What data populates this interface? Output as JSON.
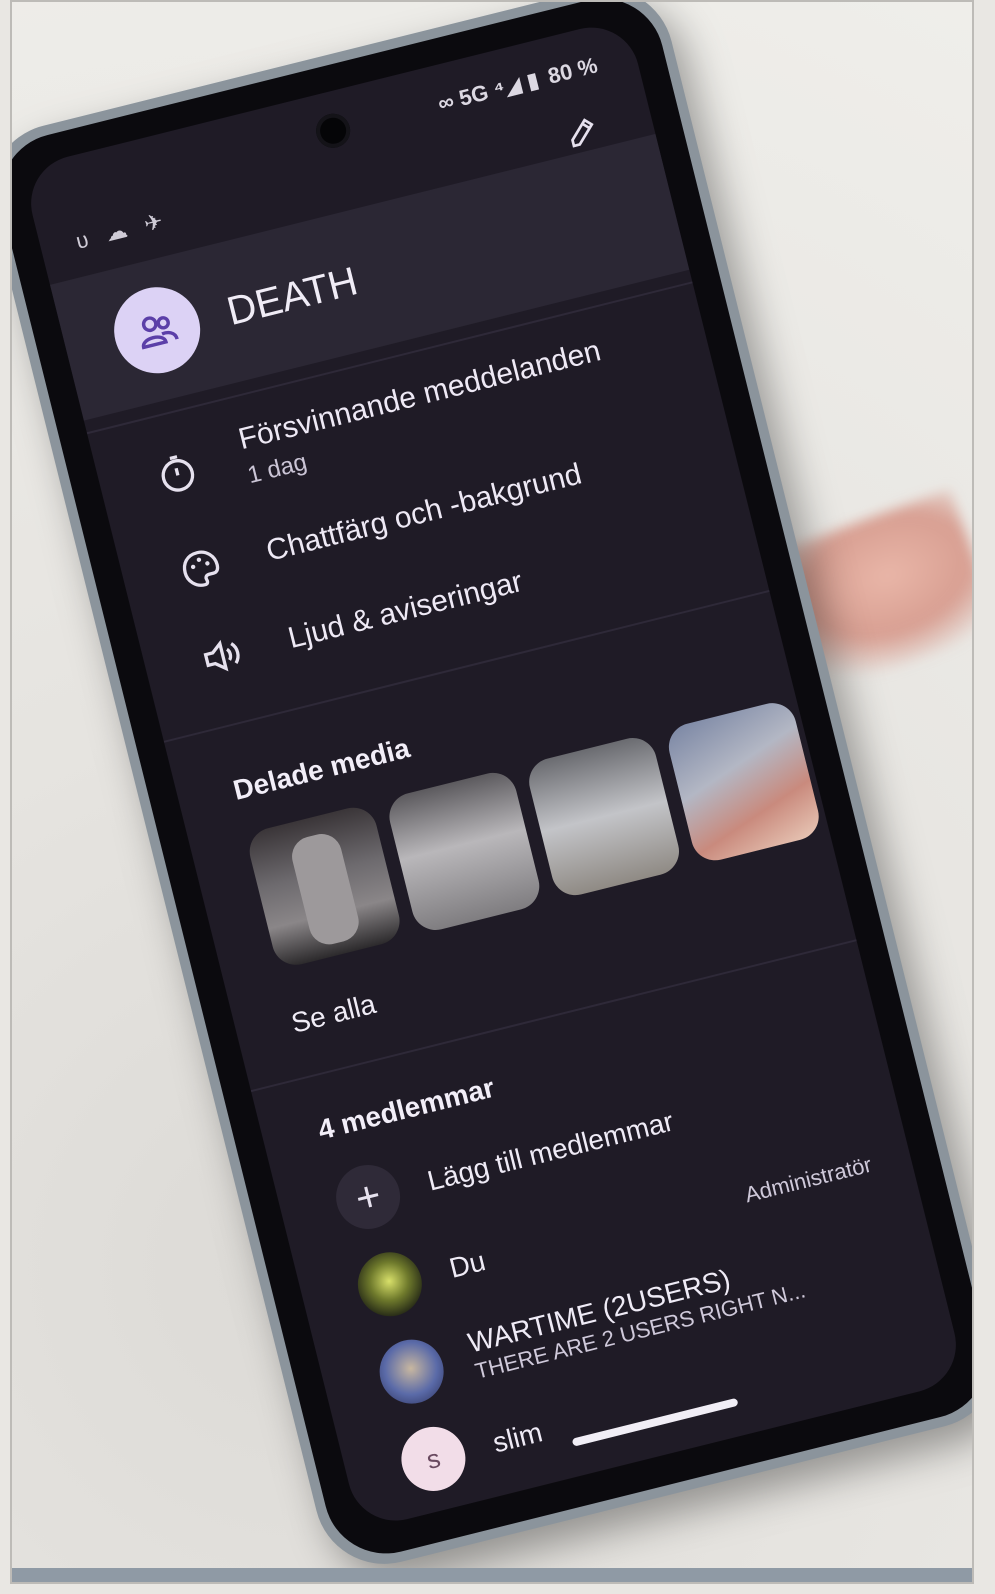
{
  "status_bar": {
    "left_glyphs": "υ ☁ ✈",
    "signal": "∞ 5G ⁴◢ ▮",
    "battery": "80 %"
  },
  "header": {
    "title": "DEATH",
    "avatar_icon": "group-icon",
    "edit_icon": "pencil-icon"
  },
  "settings": [
    {
      "icon": "timer-icon",
      "label": "Försvinnande meddelanden",
      "sub": "1 dag"
    },
    {
      "icon": "palette-icon",
      "label": "Chattfärg och -bakgrund"
    },
    {
      "icon": "speaker-icon",
      "label": "Ljud & aviseringar"
    }
  ],
  "media": {
    "title": "Delade media",
    "see_all": "Se alla",
    "thumbnails": [
      "person-photo",
      "car-photo",
      "car-photo",
      "car-photo",
      "car-photo"
    ]
  },
  "members": {
    "title": "4 medlemmar",
    "add_label": "Lägg till medlemmar",
    "list": [
      {
        "name": "Du",
        "status": "",
        "role": "Administratör",
        "avatar_color": "#4a5a2a"
      },
      {
        "name": "WARTIME        (2USERS)",
        "status": "THERE ARE 2 USERS RIGHT N...",
        "role": "",
        "avatar_color": "#5a6aa8"
      },
      {
        "name": "slim",
        "status": "",
        "role": "",
        "avatar_letter": "s",
        "avatar_color": "#f2dde8"
      }
    ]
  },
  "colors": {
    "screen_bg": "#1f1b26",
    "header_bg": "#2b2734",
    "avatar_bg": "#dcd2f5"
  }
}
